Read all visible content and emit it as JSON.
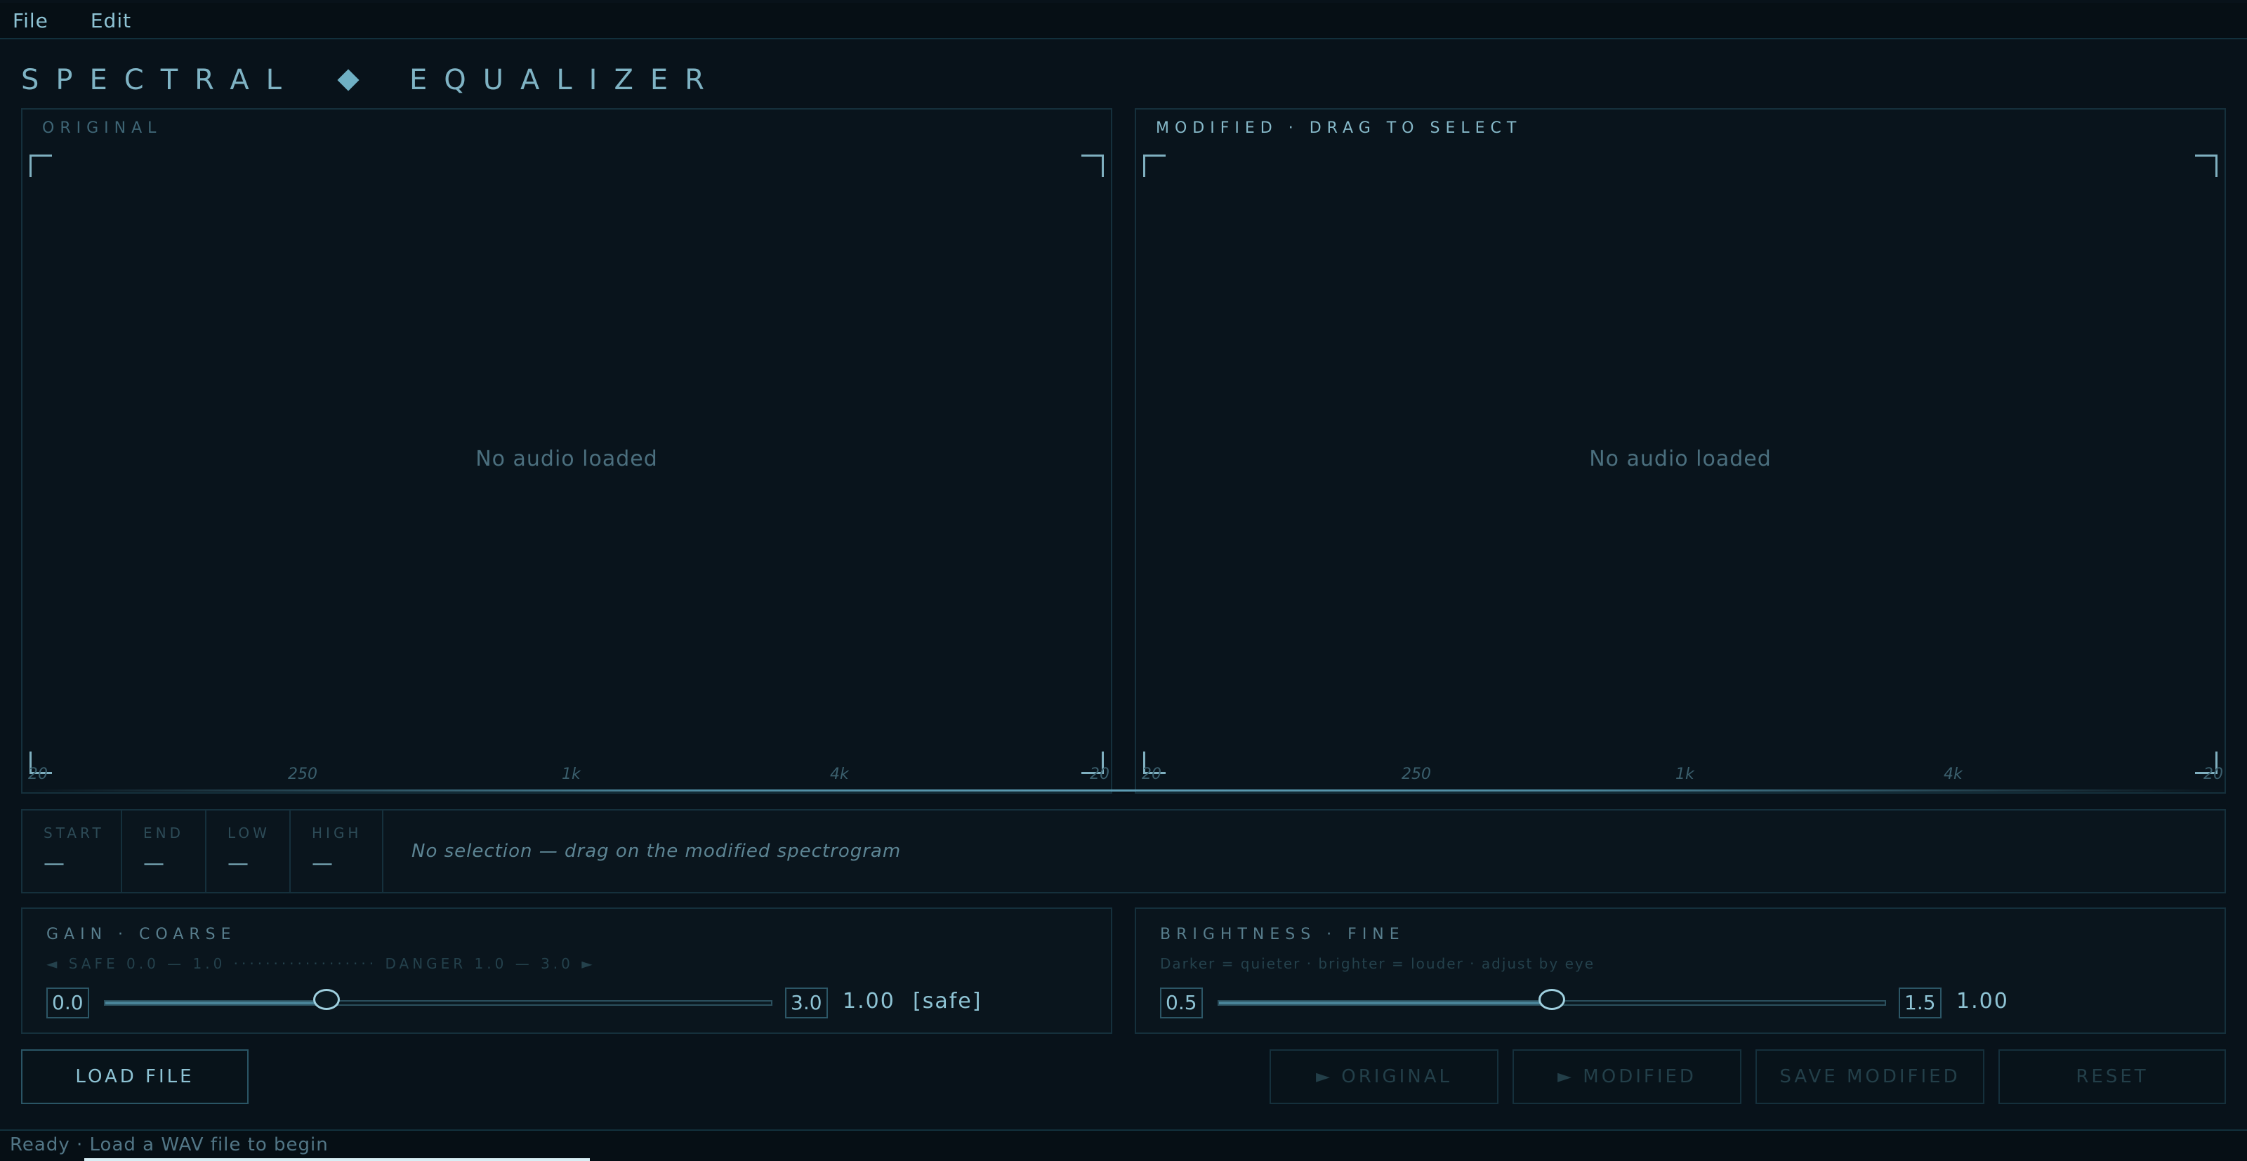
{
  "menu": {
    "file": "File",
    "edit": "Edit"
  },
  "title": {
    "left": "SPECTRAL",
    "right": "EQUALIZER"
  },
  "original": {
    "label": "ORIGINAL",
    "placeholder": "No audio loaded",
    "ticks": [
      "20",
      "250",
      "1k",
      "4k",
      "20"
    ]
  },
  "modified": {
    "label": "MODIFIED · DRAG TO SELECT",
    "placeholder": "No audio loaded",
    "ticks": [
      "20",
      "250",
      "1k",
      "4k",
      "20"
    ]
  },
  "selection": {
    "start_label": "START",
    "start_val": "—",
    "end_label": "END",
    "end_val": "—",
    "low_label": "LOW",
    "low_val": "—",
    "high_label": "HIGH",
    "high_val": "—",
    "message": "No selection — drag on the modified spectrogram"
  },
  "gain": {
    "title": "GAIN · COARSE",
    "hint": "◄ SAFE 0.0 — 1.0 ·················· DANGER 1.0 — 3.0 ►",
    "min": "0.0",
    "max": "3.0",
    "value": "1.00",
    "state": "[safe]",
    "fraction": 0.333
  },
  "brightness": {
    "title": "BRIGHTNESS · FINE",
    "hint": "Darker = quieter · brighter = louder · adjust by eye",
    "min": "0.5",
    "max": "1.5",
    "value": "1.00",
    "fraction": 0.5
  },
  "buttons": {
    "load": "LOAD FILE",
    "play_original": "► ORIGINAL",
    "play_modified": "► MODIFIED",
    "save": "SAVE MODIFIED",
    "reset": "RESET"
  },
  "status": "Ready · Load a WAV file to begin"
}
